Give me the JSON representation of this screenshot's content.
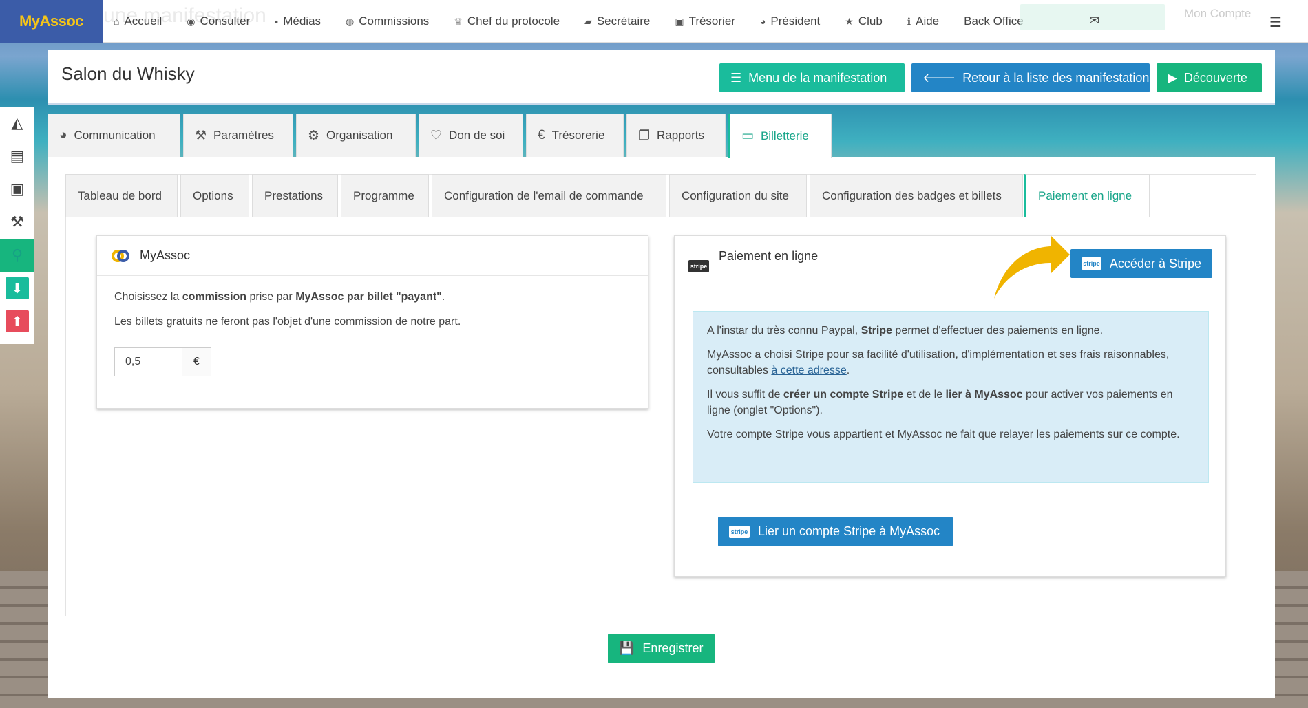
{
  "brand": "MyAssoc",
  "ghost_title": "une manifestation",
  "nav": [
    {
      "icon": "home-icon",
      "glyph": "⌂",
      "label": "Accueil"
    },
    {
      "icon": "eye-icon",
      "glyph": "◉",
      "label": "Consulter"
    },
    {
      "icon": "file-icon",
      "glyph": "▪",
      "label": "Médias"
    },
    {
      "icon": "user-circle-icon",
      "glyph": "◍",
      "label": "Commissions"
    },
    {
      "icon": "trophy-icon",
      "glyph": "♕",
      "label": "Chef du protocole"
    },
    {
      "icon": "book-icon",
      "glyph": "▰",
      "label": "Secrétaire"
    },
    {
      "icon": "money-icon",
      "glyph": "▣",
      "label": "Trésorier"
    },
    {
      "icon": "globe-icon",
      "glyph": "◕",
      "label": "Président"
    },
    {
      "icon": "star-icon",
      "glyph": "★",
      "label": "Club"
    },
    {
      "icon": "info-icon",
      "glyph": "ℹ",
      "label": "Aide"
    },
    {
      "icon": "",
      "glyph": "",
      "label": "Back Office"
    }
  ],
  "account_ghost": "Mon Compte",
  "page_title": "Salon du Whisky",
  "header_buttons": {
    "menu": "Menu de la manifestation",
    "back": "Retour à la liste des manifestations",
    "discover": "Découverte"
  },
  "main_tabs": [
    "Communication",
    "Paramètres",
    "Organisation",
    "Don de soi",
    "Trésorerie",
    "Rapports",
    "Billetterie"
  ],
  "active_main_tab": "Billetterie",
  "sub_tabs": [
    "Tableau de bord",
    "Options",
    "Prestations",
    "Programme",
    "Configuration de l'email de commande",
    "Configuration du site",
    "Configuration des badges et billets",
    "Paiement en ligne"
  ],
  "active_sub_tab": "Paiement en ligne",
  "left_card": {
    "title": "MyAssoc",
    "line1_a": "Choisissez la ",
    "line1_b": "commission",
    "line1_c": " prise par ",
    "line1_d": "MyAssoc par billet \"payant\"",
    "line1_e": ".",
    "line2": "Les billets gratuits ne feront pas l'objet d'une commission de notre part.",
    "commission_value": "0,5",
    "currency": "€"
  },
  "right_card": {
    "title": "Paiement en ligne",
    "stripe_badge": "stripe",
    "access_button": "Accéder à Stripe",
    "info": {
      "p1_a": "A l'instar du très connu Paypal, ",
      "p1_b": "Stripe",
      "p1_c": " permet d'effectuer des paiements en ligne.",
      "p2_a": "MyAssoc a choisi Stripe pour sa facilité d'utilisation, d'implémentation et ses frais raisonnables, consultables ",
      "p2_link": "à cette adresse",
      "p2_c": ".",
      "p3_a": "Il vous suffit de ",
      "p3_b": "créer un compte Stripe",
      "p3_c": " et de le ",
      "p3_d": "lier à MyAssoc",
      "p3_e": " pour activer vos paiements en ligne (onglet \"Options\").",
      "p4": "Votre compte Stripe vous appartient et MyAssoc ne fait que relayer les paiements sur ce compte."
    },
    "link_button": "Lier un compte Stripe à MyAssoc"
  },
  "save_button": "Enregistrer",
  "colors": {
    "brand_bg": "#3b5ca8",
    "brand_text": "#f5c518",
    "teal": "#1abc9c",
    "blue": "#2385c6",
    "green": "#17b57e",
    "arrow": "#f0b400"
  }
}
